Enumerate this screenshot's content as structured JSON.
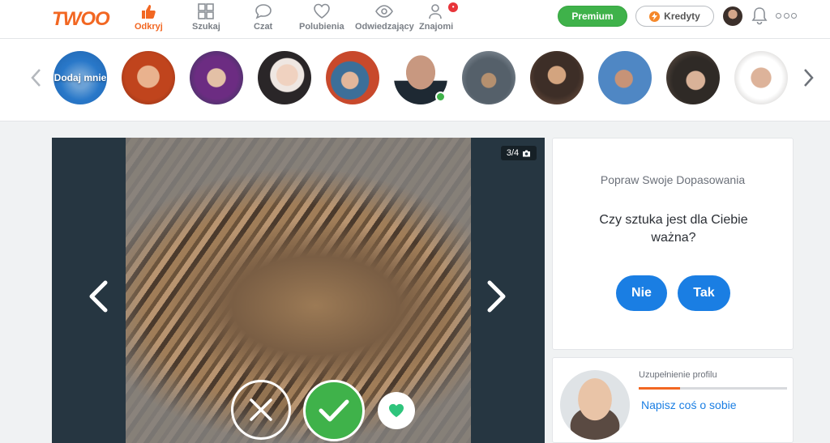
{
  "header": {
    "logo": "TWOO",
    "nav": [
      {
        "label": "Odkryj",
        "icon": "thumbs-up-icon",
        "active": true
      },
      {
        "label": "Szukaj",
        "icon": "grid-icon",
        "active": false
      },
      {
        "label": "Czat",
        "icon": "chat-bubble-icon",
        "active": false
      },
      {
        "label": "Polubienia",
        "icon": "heart-icon",
        "active": false
      },
      {
        "label": "Odwiedzający",
        "icon": "eye-icon",
        "active": false
      },
      {
        "label": "Znajomi",
        "icon": "person-icon",
        "active": false
      }
    ],
    "premium_label": "Premium",
    "credits_label": "Kredyty",
    "accent_color": "#f26722",
    "premium_color": "#3fb24a"
  },
  "stories": {
    "add_label": "Dodaj mnie",
    "count": 11
  },
  "photo": {
    "counter": "3/4"
  },
  "question_panel": {
    "title": "Popraw Swoje Dopasowania",
    "question": "Czy sztuka jest dla Ciebie ważna?",
    "no_label": "Nie",
    "yes_label": "Tak",
    "button_color": "#1a7ee3"
  },
  "profile_panel": {
    "progress_label": "Uzupełnienie profilu",
    "progress_fraction": 0.28,
    "link_label": "Napisz coś o sobie"
  }
}
